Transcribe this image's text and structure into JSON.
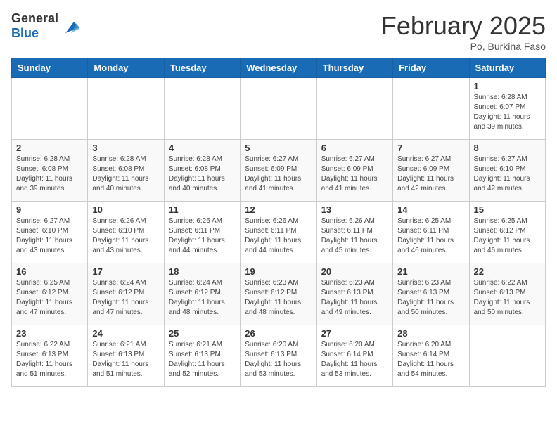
{
  "header": {
    "logo_general": "General",
    "logo_blue": "Blue",
    "month_title": "February 2025",
    "location": "Po, Burkina Faso"
  },
  "weekdays": [
    "Sunday",
    "Monday",
    "Tuesday",
    "Wednesday",
    "Thursday",
    "Friday",
    "Saturday"
  ],
  "weeks": [
    [
      {
        "day": "",
        "info": ""
      },
      {
        "day": "",
        "info": ""
      },
      {
        "day": "",
        "info": ""
      },
      {
        "day": "",
        "info": ""
      },
      {
        "day": "",
        "info": ""
      },
      {
        "day": "",
        "info": ""
      },
      {
        "day": "1",
        "info": "Sunrise: 6:28 AM\nSunset: 6:07 PM\nDaylight: 11 hours\nand 39 minutes."
      }
    ],
    [
      {
        "day": "2",
        "info": "Sunrise: 6:28 AM\nSunset: 6:08 PM\nDaylight: 11 hours\nand 39 minutes."
      },
      {
        "day": "3",
        "info": "Sunrise: 6:28 AM\nSunset: 6:08 PM\nDaylight: 11 hours\nand 40 minutes."
      },
      {
        "day": "4",
        "info": "Sunrise: 6:28 AM\nSunset: 6:08 PM\nDaylight: 11 hours\nand 40 minutes."
      },
      {
        "day": "5",
        "info": "Sunrise: 6:27 AM\nSunset: 6:09 PM\nDaylight: 11 hours\nand 41 minutes."
      },
      {
        "day": "6",
        "info": "Sunrise: 6:27 AM\nSunset: 6:09 PM\nDaylight: 11 hours\nand 41 minutes."
      },
      {
        "day": "7",
        "info": "Sunrise: 6:27 AM\nSunset: 6:09 PM\nDaylight: 11 hours\nand 42 minutes."
      },
      {
        "day": "8",
        "info": "Sunrise: 6:27 AM\nSunset: 6:10 PM\nDaylight: 11 hours\nand 42 minutes."
      }
    ],
    [
      {
        "day": "9",
        "info": "Sunrise: 6:27 AM\nSunset: 6:10 PM\nDaylight: 11 hours\nand 43 minutes."
      },
      {
        "day": "10",
        "info": "Sunrise: 6:26 AM\nSunset: 6:10 PM\nDaylight: 11 hours\nand 43 minutes."
      },
      {
        "day": "11",
        "info": "Sunrise: 6:26 AM\nSunset: 6:11 PM\nDaylight: 11 hours\nand 44 minutes."
      },
      {
        "day": "12",
        "info": "Sunrise: 6:26 AM\nSunset: 6:11 PM\nDaylight: 11 hours\nand 44 minutes."
      },
      {
        "day": "13",
        "info": "Sunrise: 6:26 AM\nSunset: 6:11 PM\nDaylight: 11 hours\nand 45 minutes."
      },
      {
        "day": "14",
        "info": "Sunrise: 6:25 AM\nSunset: 6:11 PM\nDaylight: 11 hours\nand 46 minutes."
      },
      {
        "day": "15",
        "info": "Sunrise: 6:25 AM\nSunset: 6:12 PM\nDaylight: 11 hours\nand 46 minutes."
      }
    ],
    [
      {
        "day": "16",
        "info": "Sunrise: 6:25 AM\nSunset: 6:12 PM\nDaylight: 11 hours\nand 47 minutes."
      },
      {
        "day": "17",
        "info": "Sunrise: 6:24 AM\nSunset: 6:12 PM\nDaylight: 11 hours\nand 47 minutes."
      },
      {
        "day": "18",
        "info": "Sunrise: 6:24 AM\nSunset: 6:12 PM\nDaylight: 11 hours\nand 48 minutes."
      },
      {
        "day": "19",
        "info": "Sunrise: 6:23 AM\nSunset: 6:12 PM\nDaylight: 11 hours\nand 48 minutes."
      },
      {
        "day": "20",
        "info": "Sunrise: 6:23 AM\nSunset: 6:13 PM\nDaylight: 11 hours\nand 49 minutes."
      },
      {
        "day": "21",
        "info": "Sunrise: 6:23 AM\nSunset: 6:13 PM\nDaylight: 11 hours\nand 50 minutes."
      },
      {
        "day": "22",
        "info": "Sunrise: 6:22 AM\nSunset: 6:13 PM\nDaylight: 11 hours\nand 50 minutes."
      }
    ],
    [
      {
        "day": "23",
        "info": "Sunrise: 6:22 AM\nSunset: 6:13 PM\nDaylight: 11 hours\nand 51 minutes."
      },
      {
        "day": "24",
        "info": "Sunrise: 6:21 AM\nSunset: 6:13 PM\nDaylight: 11 hours\nand 51 minutes."
      },
      {
        "day": "25",
        "info": "Sunrise: 6:21 AM\nSunset: 6:13 PM\nDaylight: 11 hours\nand 52 minutes."
      },
      {
        "day": "26",
        "info": "Sunrise: 6:20 AM\nSunset: 6:13 PM\nDaylight: 11 hours\nand 53 minutes."
      },
      {
        "day": "27",
        "info": "Sunrise: 6:20 AM\nSunset: 6:14 PM\nDaylight: 11 hours\nand 53 minutes."
      },
      {
        "day": "28",
        "info": "Sunrise: 6:20 AM\nSunset: 6:14 PM\nDaylight: 11 hours\nand 54 minutes."
      },
      {
        "day": "",
        "info": ""
      }
    ]
  ]
}
